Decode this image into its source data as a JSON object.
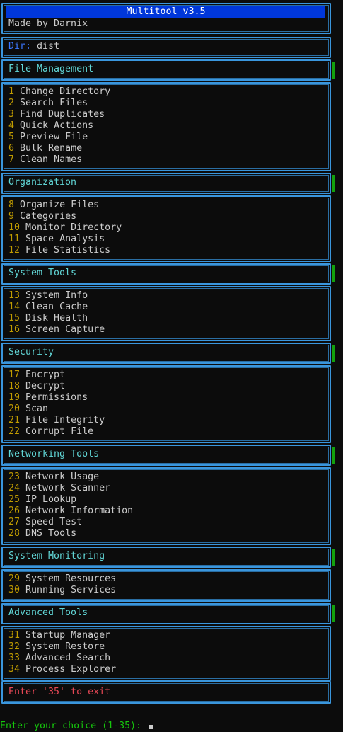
{
  "header": {
    "title": "Multitool v3.5",
    "author": "Made by Darnix"
  },
  "dir": {
    "label": "Dir:",
    "value": "dist"
  },
  "sections": [
    {
      "title": "File Management",
      "items": [
        {
          "num": "1",
          "label": "Change Directory"
        },
        {
          "num": "2",
          "label": "Search Files"
        },
        {
          "num": "3",
          "label": "Find Duplicates"
        },
        {
          "num": "4",
          "label": "Quick Actions"
        },
        {
          "num": "5",
          "label": "Preview File"
        },
        {
          "num": "6",
          "label": "Bulk Rename"
        },
        {
          "num": "7",
          "label": "Clean Names"
        }
      ]
    },
    {
      "title": "Organization",
      "items": [
        {
          "num": "8",
          "label": "Organize Files"
        },
        {
          "num": "9",
          "label": "Categories"
        },
        {
          "num": "10",
          "label": "Monitor Directory"
        },
        {
          "num": "11",
          "label": "Space Analysis"
        },
        {
          "num": "12",
          "label": "File Statistics"
        }
      ]
    },
    {
      "title": "System Tools",
      "items": [
        {
          "num": "13",
          "label": "System Info"
        },
        {
          "num": "14",
          "label": "Clean Cache"
        },
        {
          "num": "15",
          "label": "Disk Health"
        },
        {
          "num": "16",
          "label": "Screen Capture"
        }
      ]
    },
    {
      "title": "Security",
      "items": [
        {
          "num": "17",
          "label": "Encrypt"
        },
        {
          "num": "18",
          "label": "Decrypt"
        },
        {
          "num": "19",
          "label": "Permissions"
        },
        {
          "num": "20",
          "label": "Scan"
        },
        {
          "num": "21",
          "label": "File Integrity"
        },
        {
          "num": "22",
          "label": "Corrupt File"
        }
      ]
    },
    {
      "title": "Networking Tools",
      "items": [
        {
          "num": "23",
          "label": "Network Usage"
        },
        {
          "num": "24",
          "label": "Network Scanner"
        },
        {
          "num": "25",
          "label": "IP Lookup"
        },
        {
          "num": "26",
          "label": "Network Information"
        },
        {
          "num": "27",
          "label": "Speed Test"
        },
        {
          "num": "28",
          "label": "DNS Tools"
        }
      ]
    },
    {
      "title": "System Monitoring",
      "items": [
        {
          "num": "29",
          "label": "System Resources"
        },
        {
          "num": "30",
          "label": "Running Services"
        }
      ]
    },
    {
      "title": "Advanced Tools",
      "items": [
        {
          "num": "31",
          "label": "Startup Manager"
        },
        {
          "num": "32",
          "label": "System Restore"
        },
        {
          "num": "33",
          "label": "Advanced Search"
        },
        {
          "num": "34",
          "label": "Process Explorer"
        }
      ]
    }
  ],
  "exit_hint": "Enter '35' to exit",
  "prompt": "Enter your choice (1-35): ",
  "colors": {
    "border": "#3a96dd",
    "title_bg": "#0037da",
    "section": "#61d6d6",
    "number": "#c19c00",
    "exit": "#e74856",
    "prompt": "#16c60c"
  }
}
